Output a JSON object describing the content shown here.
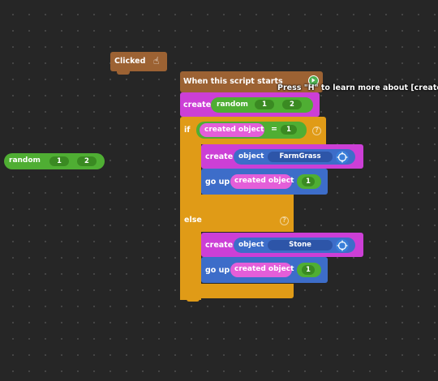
{
  "tooltip": "Press \"H\" to learn more about [create]",
  "clicked_block": {
    "label": "Clicked"
  },
  "floating_random": {
    "label": "random",
    "min": "1",
    "max": "2"
  },
  "script": {
    "hat_label": "When this script starts",
    "create_random": {
      "keyword": "create",
      "label": "random",
      "min": "1",
      "max": "2"
    },
    "if_block": {
      "keyword": "if",
      "condition_var": "created object",
      "operator": "=",
      "value": "1",
      "then": [
        {
          "keyword": "create",
          "object_label": "object",
          "object_name": "FarmGrass"
        },
        {
          "keyword": "go up",
          "var": "created object",
          "amount": "1"
        }
      ],
      "else_label": "else",
      "else": [
        {
          "keyword": "create",
          "object_label": "object",
          "object_name": "Stone"
        },
        {
          "keyword": "go up",
          "var": "created object",
          "amount": "1"
        }
      ]
    }
  },
  "colors": {
    "event_brown": "#9c6233",
    "create_magenta": "#cc3fd6",
    "random_green": "#4fae33",
    "control_orange": "#e09b17",
    "motion_blue": "#3d6dc9",
    "var_pink": "#e45ed9",
    "number_green": "#5da32a"
  }
}
